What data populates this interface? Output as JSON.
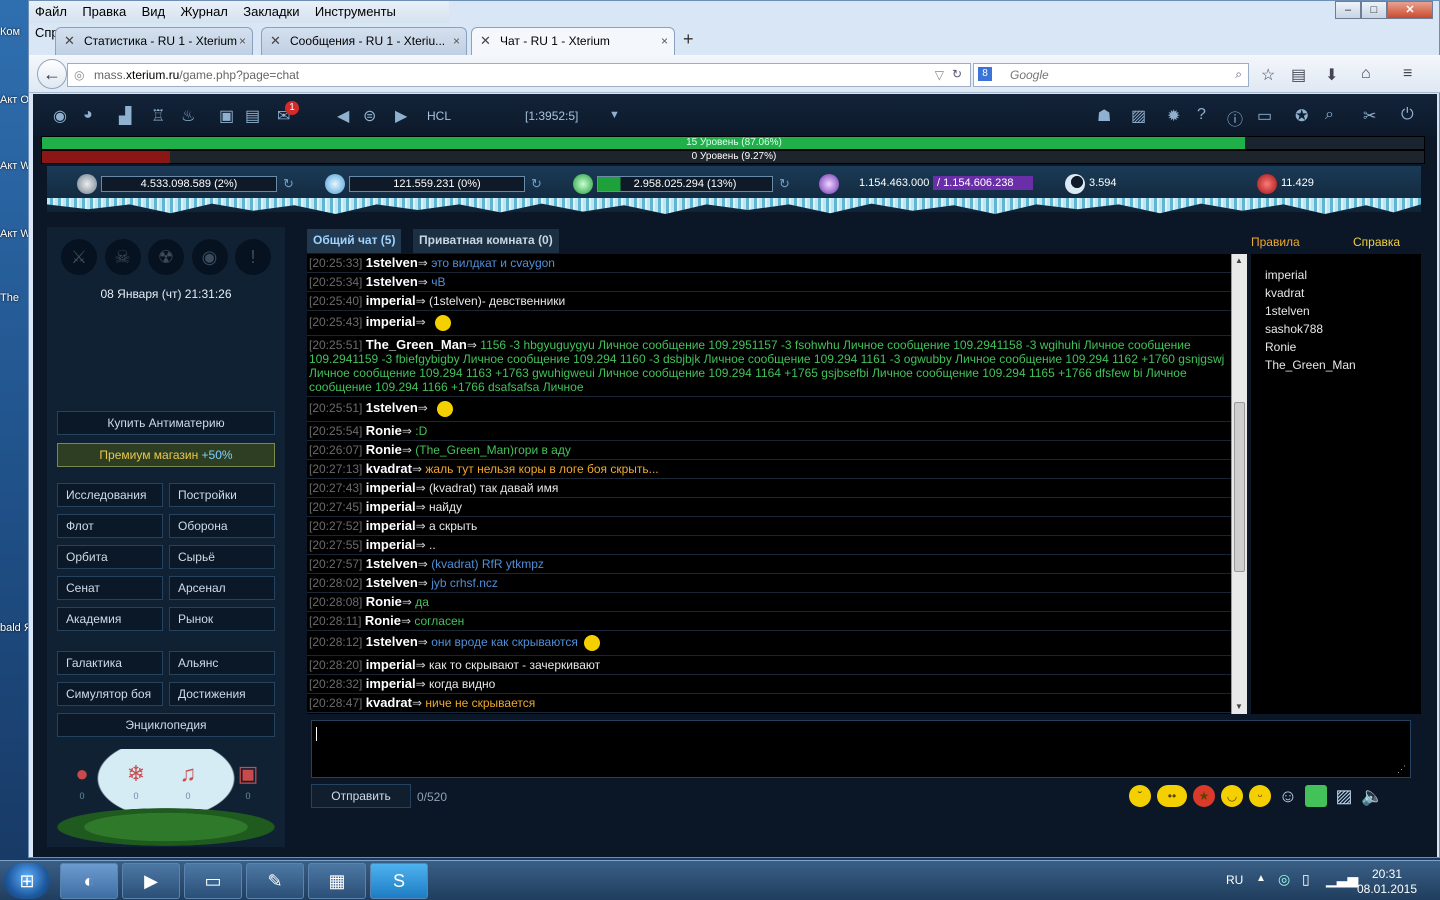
{
  "desktop": {
    "icons": [
      "Ком",
      "Акт Offi",
      "Акт Wir",
      "Акт Wir",
      "The",
      "bald Я"
    ]
  },
  "browser": {
    "menu": [
      "Файл",
      "Правка",
      "Вид",
      "Журнал",
      "Закладки",
      "Инструменты",
      "Справка"
    ],
    "tabs": [
      {
        "label": "Статистика - RU 1 - Xterium",
        "close": "×"
      },
      {
        "label": "Сообщения - RU 1 - Xteriu...",
        "close": "×"
      },
      {
        "label": "Чат - RU 1 - Xterium",
        "close": "×"
      }
    ],
    "newtab": "+",
    "url_prefix": "mass.",
    "url_host": "xterium.ru",
    "url_path": "/game.php?page=chat",
    "search_placeholder": "Google",
    "search_badge": "8"
  },
  "game": {
    "mail_badge": "1",
    "planet_name": "HCL",
    "planet_coords": "[1:3952:5]",
    "level1_text": "15 Уровень (87.06%)",
    "level1_progress": 87.06,
    "level2_text": "0 Уровень (9.27%)",
    "level2_progress": 9.27,
    "resources": {
      "metal": "4.533.098.589 (2%)",
      "crystal": "121.559.231 (0%)",
      "deuterium": "2.958.025.294 (13%)",
      "energy_used": "1.154.463.000",
      "energy_total": "/ 1.154.606.238",
      "darkmatter": "3.594",
      "antimatter": "11.429"
    },
    "datetime": "08 Января (чт) 21:31:26",
    "buy_antimatter": "Купить Антиматерию",
    "premium_shop": "Премиум магазин",
    "premium_bonus": "+50%",
    "menu_col1": [
      "Исследования",
      "Флот",
      "Орбита",
      "Сенат",
      "Академия"
    ],
    "menu_col2": [
      "Постройки",
      "Оборона",
      "Сырьё",
      "Арсенал",
      "Рынок"
    ],
    "menu2_col1": [
      "Галактика",
      "Симулятор боя"
    ],
    "menu2_col2": [
      "Альянс",
      "Достижения"
    ],
    "encyclopedia": "Энциклопедия",
    "ornament_counts": [
      "0",
      "0",
      "0",
      "0"
    ]
  },
  "chat": {
    "tab_general": "Общий чат (5)",
    "tab_private": "Приватная комната (0)",
    "rules": "Правила",
    "help": "Справка",
    "messages": [
      {
        "ts": "[20:25:33]",
        "nick": "1stelven",
        "arrow": "⇒",
        "text": "это вилдкат и cvaygon",
        "color": "#4f8fd9"
      },
      {
        "ts": "[20:25:34]",
        "nick": "1stelven",
        "arrow": "⇒",
        "text": "чВ",
        "color": "#4f8fd9"
      },
      {
        "ts": "[20:25:40]",
        "nick": "imperial",
        "arrow": "⇒",
        "text": "(1stelven)- девственники",
        "color": "#e8e8e8"
      },
      {
        "ts": "[20:25:43]",
        "nick": "imperial",
        "arrow": "⇒",
        "text": "",
        "color": "#e8e8e8",
        "smile": true
      },
      {
        "ts": "[20:25:51]",
        "nick": "The_Green_Man",
        "arrow": "⇒",
        "text": "1156 -3 hbgyuguygyu Личное сообщение 109.2951157 -3 fsohwhu Личное сообщение 109.2941158 -3 wgihuhi Личное сообщение 109.2941159 -3 fbiefgybigby Личное сообщение 109.294 1160 -3 dsbjbjk Личное сообщение 109.294 1161 -3 ogwubby Личное сообщение 109.294 1162 +1760 gsnjgswj Личное сообщение 109.294 1163 +1763 gwuhigweui Личное сообщение 109.294 1164 +1765 gsjbsefbi Личное сообщение 109.294 1165 +1766 dfsfew bi Личное сообщение 109.294 1166 +1766 dsafsafsa Личное",
        "color": "#43c25a",
        "wrap": true
      },
      {
        "ts": "[20:25:51]",
        "nick": "1stelven",
        "arrow": "⇒",
        "text": "",
        "color": "#4f8fd9",
        "smile": true
      },
      {
        "ts": "[20:25:54]",
        "nick": "Ronie",
        "arrow": "⇒",
        "text": ":D",
        "color": "#43c25a"
      },
      {
        "ts": "[20:26:07]",
        "nick": "Ronie",
        "arrow": "⇒",
        "text": "(The_Green_Man)гори в аду",
        "color": "#43c25a"
      },
      {
        "ts": "[20:27:13]",
        "nick": "kvadrat",
        "arrow": "⇒",
        "text": "жаль тут нельзя коры в логе боя скрыть...",
        "color": "#f0a92e"
      },
      {
        "ts": "[20:27:43]",
        "nick": "imperial",
        "arrow": "⇒",
        "text": "(kvadrat) так давай имя",
        "color": "#e8e8e8"
      },
      {
        "ts": "[20:27:45]",
        "nick": "imperial",
        "arrow": "⇒",
        "text": " найду",
        "color": "#e8e8e8"
      },
      {
        "ts": "[20:27:52]",
        "nick": "imperial",
        "arrow": "⇒",
        "text": "а скрыть",
        "color": "#e8e8e8"
      },
      {
        "ts": "[20:27:55]",
        "nick": "imperial",
        "arrow": "⇒",
        "text": "..",
        "color": "#e8e8e8"
      },
      {
        "ts": "[20:27:57]",
        "nick": "1stelven",
        "arrow": "⇒",
        "text": "(kvadrat) RfR ytkmpz",
        "color": "#4f8fd9"
      },
      {
        "ts": "[20:28:02]",
        "nick": "1stelven",
        "arrow": "⇒",
        "text": "jyb crhsf.ncz",
        "color": "#4f8fd9"
      },
      {
        "ts": "[20:28:08]",
        "nick": "Ronie",
        "arrow": "⇒",
        "text": "да",
        "color": "#43c25a"
      },
      {
        "ts": "[20:28:11]",
        "nick": "Ronie",
        "arrow": "⇒",
        "text": "согласен",
        "color": "#43c25a"
      },
      {
        "ts": "[20:28:12]",
        "nick": "1stelven",
        "arrow": "⇒",
        "text": "они вроде как скрываются",
        "color": "#4f8fd9",
        "smile": true
      },
      {
        "ts": "[20:28:20]",
        "nick": "imperial",
        "arrow": "⇒",
        "text": "как то скрывают - зачеркивают",
        "color": "#e8e8e8"
      },
      {
        "ts": "[20:28:32]",
        "nick": "imperial",
        "arrow": "⇒",
        "text": "когда видно",
        "color": "#e8e8e8"
      },
      {
        "ts": "[20:28:47]",
        "nick": "kvadrat",
        "arrow": "⇒",
        "text": "ниче не скрывается",
        "color": "#f0a92e"
      }
    ],
    "users": [
      "imperial",
      "kvadrat",
      "1stelven",
      "sashok788",
      "Ronie",
      "The_Green_Man"
    ],
    "send": "Отправить",
    "counter": "0/520"
  },
  "taskbar": {
    "lang": "RU",
    "time": "20:31",
    "date": "08.01.2015"
  }
}
